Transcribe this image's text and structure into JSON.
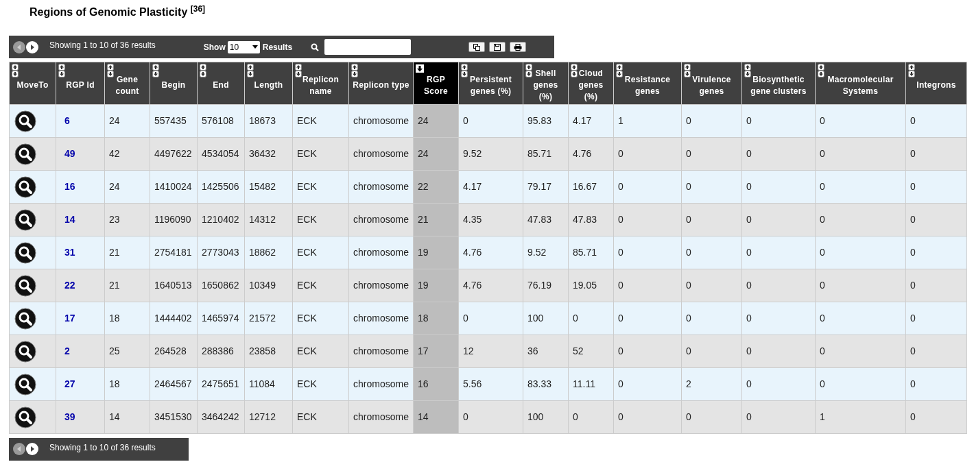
{
  "title": "Regions of Genomic Plasticity $^{[36]}$",
  "top_bar": {
    "prev_disabled": true,
    "next_disabled": false,
    "info": "Showing 1 to 10 of 36 results",
    "show_label": "Show",
    "page_size": "10",
    "results_label": "Results"
  },
  "table": {
    "columns": [
      {
        "label": "MoveTo",
        "sorted": false,
        "sortable": true
      },
      {
        "label": "RGP Id",
        "sorted": false,
        "sortable": true
      },
      {
        "label": "Gene count",
        "sorted": false,
        "sortable": true
      },
      {
        "label": "Begin",
        "sorted": false,
        "sortable": true
      },
      {
        "label": "End",
        "sorted": false,
        "sortable": true
      },
      {
        "label": "Length",
        "sorted": false,
        "sortable": true
      },
      {
        "label": "Replicon name",
        "sorted": false,
        "sortable": true
      },
      {
        "label": "Replicon type",
        "sorted": false,
        "sortable": true
      },
      {
        "label": "RGP Score",
        "sorted": true,
        "sortable": true
      },
      {
        "label": "Persistent genes (%)",
        "sorted": false,
        "sortable": true
      },
      {
        "label": "Shell genes (%)",
        "sorted": false,
        "sortable": true
      },
      {
        "label": "Cloud genes (%)",
        "sorted": false,
        "sortable": true
      },
      {
        "label": "Resistance genes",
        "sorted": false,
        "sortable": true
      },
      {
        "label": "Virulence genes",
        "sorted": false,
        "sortable": true
      },
      {
        "label": "Biosynthetic gene clusters",
        "sorted": false,
        "sortable": true
      },
      {
        "label": "Macromolecular Systems",
        "sorted": false,
        "sortable": true
      },
      {
        "label": "Integrons",
        "sorted": false,
        "sortable": true
      }
    ],
    "rows": [
      {
        "cells": [
          "",
          "6",
          "24",
          "557435",
          "576108",
          "18673",
          "ECK",
          "chromosome",
          "24",
          "0",
          "95.83",
          "4.17",
          "1",
          "0",
          "0",
          "0",
          "0"
        ]
      },
      {
        "cells": [
          "",
          "49",
          "42",
          "4497622",
          "4534054",
          "36432",
          "ECK",
          "chromosome",
          "24",
          "9.52",
          "85.71",
          "4.76",
          "0",
          "0",
          "0",
          "0",
          "0"
        ]
      },
      {
        "cells": [
          "",
          "16",
          "24",
          "1410024",
          "1425506",
          "15482",
          "ECK",
          "chromosome",
          "22",
          "4.17",
          "79.17",
          "16.67",
          "0",
          "0",
          "0",
          "0",
          "0"
        ]
      },
      {
        "cells": [
          "",
          "14",
          "23",
          "1196090",
          "1210402",
          "14312",
          "ECK",
          "chromosome",
          "21",
          "4.35",
          "47.83",
          "47.83",
          "0",
          "0",
          "0",
          "0",
          "0"
        ]
      },
      {
        "cells": [
          "",
          "31",
          "21",
          "2754181",
          "2773043",
          "18862",
          "ECK",
          "chromosome",
          "19",
          "4.76",
          "9.52",
          "85.71",
          "0",
          "0",
          "0",
          "0",
          "0"
        ]
      },
      {
        "cells": [
          "",
          "22",
          "21",
          "1640513",
          "1650862",
          "10349",
          "ECK",
          "chromosome",
          "19",
          "4.76",
          "76.19",
          "19.05",
          "0",
          "0",
          "0",
          "0",
          "0"
        ]
      },
      {
        "cells": [
          "",
          "17",
          "18",
          "1444402",
          "1465974",
          "21572",
          "ECK",
          "chromosome",
          "18",
          "0",
          "100",
          "0",
          "0",
          "0",
          "0",
          "0",
          "0"
        ]
      },
      {
        "cells": [
          "",
          "2",
          "25",
          "264528",
          "288386",
          "23858",
          "ECK",
          "chromosome",
          "17",
          "12",
          "36",
          "52",
          "0",
          "0",
          "0",
          "0",
          "0"
        ]
      },
      {
        "cells": [
          "",
          "27",
          "18",
          "2464567",
          "2475651",
          "11084",
          "ECK",
          "chromosome",
          "16",
          "5.56",
          "83.33",
          "11.11",
          "0",
          "2",
          "0",
          "0",
          "0"
        ]
      },
      {
        "cells": [
          "",
          "39",
          "14",
          "3451530",
          "3464242",
          "12712",
          "ECK",
          "chromosome",
          "14",
          "0",
          "100",
          "0",
          "0",
          "0",
          "0",
          "1",
          "0"
        ]
      }
    ]
  },
  "bottom_bar": {
    "prev_disabled": true,
    "next_disabled": false,
    "info": "Showing 1 to 10 of 36 results"
  }
}
